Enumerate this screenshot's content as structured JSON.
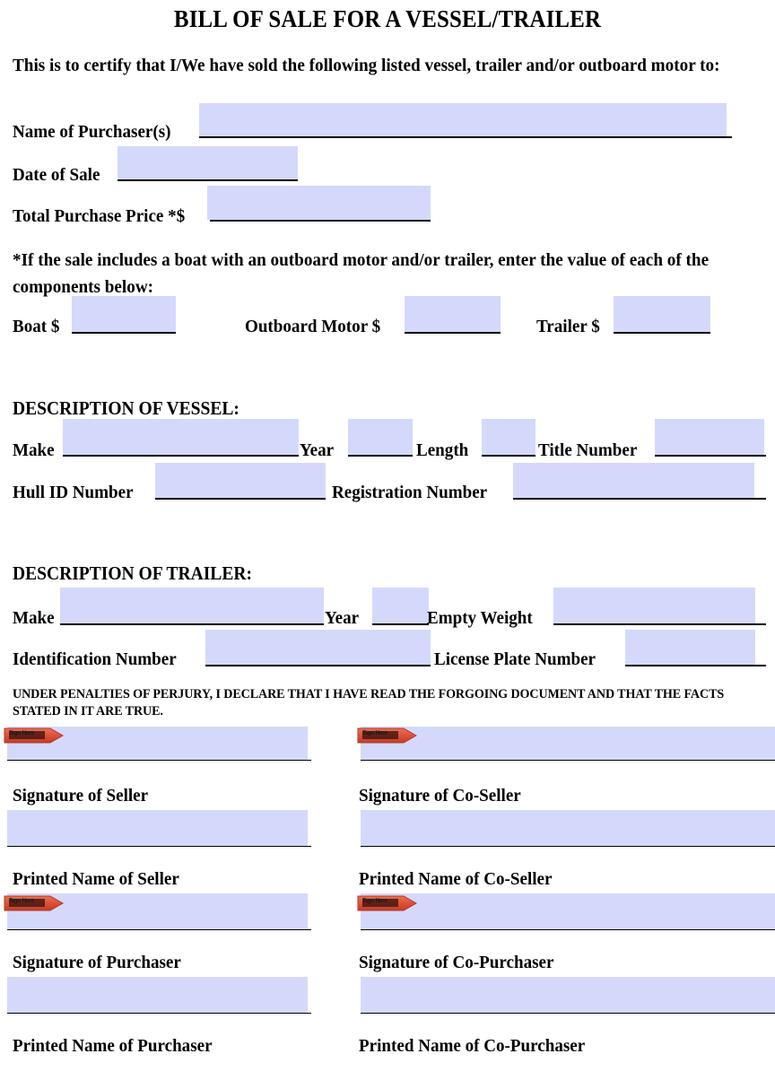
{
  "document": {
    "title": "BILL OF SALE FOR A VESSEL/TRAILER",
    "intro": "This is to certify that I/We have sold the following listed vessel, trailer and/or outboard motor to:",
    "component_note": "*If the sale includes a boat with an outboard motor and/or trailer, enter the value of each of the components below:",
    "perjury": "UNDER PENALTIES OF PERJURY, I DECLARE THAT I HAVE READ THE FORGOING DOCUMENT AND THAT THE FACTS STATED IN IT ARE TRUE."
  },
  "colors": {
    "field_fill": "#d4d9fb",
    "sign_tag": "#e0533b",
    "text": "#000000",
    "page": "#ffffff"
  },
  "buyer_section": {
    "name_of_purchasers_label": "Name of Purchaser(s)",
    "name_of_purchasers_value": "",
    "date_of_sale_label": "Date of Sale",
    "date_of_sale_value": "",
    "total_purchase_price_label": "Total Purchase Price *$",
    "total_purchase_price_value": ""
  },
  "component_values": {
    "boat_label": "Boat $",
    "boat_value": "",
    "outboard_motor_label": "Outboard Motor $",
    "outboard_motor_value": "",
    "trailer_label": "Trailer $",
    "trailer_value": ""
  },
  "vessel": {
    "heading": "DESCRIPTION OF VESSEL:",
    "make_label": "Make",
    "make_value": "",
    "year_label": "Year",
    "year_value": "",
    "length_label": "Length",
    "length_value": "",
    "title_number_label": "Title Number",
    "title_number_value": "",
    "hull_id_label": "Hull ID Number",
    "hull_id_value": "",
    "registration_label": "Registration Number",
    "registration_value": ""
  },
  "trailer": {
    "heading": "DESCRIPTION OF TRAILER:",
    "make_label": "Make",
    "make_value": "",
    "year_label": "Year",
    "year_value": "",
    "empty_weight_label": "Empty Weight",
    "empty_weight_value": "",
    "identification_label": "Identification Number",
    "identification_value": "",
    "license_plate_label": "License Plate Number",
    "license_plate_value": ""
  },
  "signatures": {
    "sign_here_tag": "Sign Here",
    "seller_signature_label": "Signature of Seller",
    "seller_signature_value": "",
    "co_seller_signature_label": "Signature of Co-Seller",
    "co_seller_signature_value": "",
    "seller_printed_label": "Printed Name of Seller",
    "seller_printed_value": "",
    "co_seller_printed_label": "Printed Name of Co-Seller",
    "co_seller_printed_value": "",
    "purchaser_signature_label": "Signature of Purchaser",
    "purchaser_signature_value": "",
    "co_purchaser_signature_label": "Signature of Co-Purchaser",
    "co_purchaser_signature_value": "",
    "purchaser_printed_label": "Printed Name of Purchaser",
    "purchaser_printed_value": "",
    "co_purchaser_printed_label": "Printed Name of Co-Purchaser",
    "co_purchaser_printed_value": ""
  }
}
